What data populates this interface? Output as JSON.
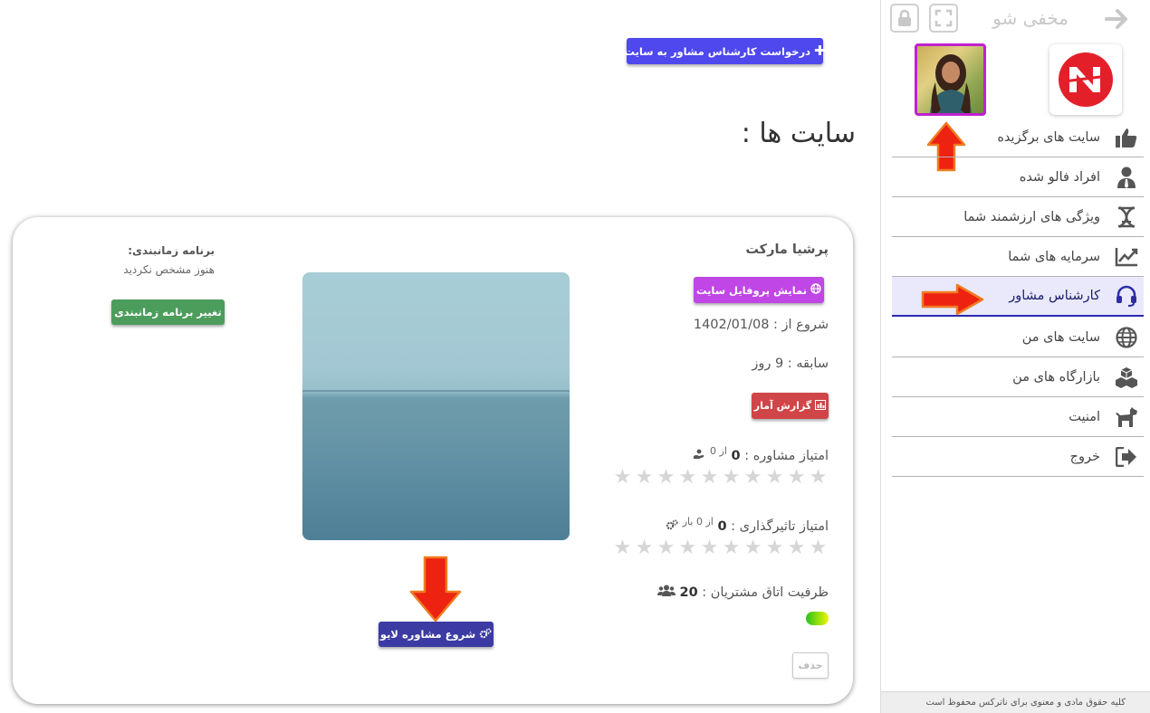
{
  "main": {
    "request_button": "درخواست کارشناس مشاور به سایت",
    "page_title": "سایت ها :",
    "card": {
      "site_name": "پرشیا مارکت",
      "profile_button": "نمایش پروفایل سایت",
      "start_label": "شروع از :",
      "start_date": "1402/01/08",
      "tenure_label": "سابقه :",
      "tenure_value": "9 روز",
      "report_button": "گزارش آمار",
      "consult_score_label": "امتیاز مشاوره :",
      "consult_score_value": "0",
      "consult_score_of": "از 0",
      "consult_score_fraction": 0,
      "impact_score_label": "امتیاز تاثیرگذاری :",
      "impact_score_value": "0",
      "impact_score_of": "از 0 بار",
      "impact_score_fraction": 0,
      "capacity_label": "ظرفیت اتاق مشتریان :",
      "capacity_value": "20",
      "delete_button": "حذف",
      "live_button": "شروع مشاوره لایو",
      "schedule_label": "برنامه زمانبندی:",
      "schedule_value": "هنوز مشخص نکردید",
      "schedule_button": "تغییر برنامه زمانبندی"
    }
  },
  "sidebar": {
    "hide_label": "مخفی شو",
    "items": [
      {
        "label": "سایت های برگزیده",
        "icon": "thumbs-up-icon"
      },
      {
        "label": "افراد فالو شده",
        "icon": "user-tie-icon"
      },
      {
        "label": "ویژگی های ارزشمند شما",
        "icon": "dna-icon"
      },
      {
        "label": "سرمایه های شما",
        "icon": "chart-line-icon"
      },
      {
        "label": "کارشناس مشاور",
        "icon": "headset-icon",
        "active": true
      },
      {
        "label": "سایت های من",
        "icon": "globe-icon"
      },
      {
        "label": "بازارگاه های من",
        "icon": "cubes-icon"
      },
      {
        "label": "امنیت",
        "icon": "dog-icon"
      },
      {
        "label": "خروج",
        "icon": "sign-out-icon"
      }
    ],
    "footer": "کلیه حقوق مادی و معنوی برای ناترکس محفوظ است"
  },
  "colors": {
    "request_button": "#4e48ee",
    "profile_button": "#c046e6",
    "report_button": "#d04547",
    "live_button": "#3b3ba3",
    "schedule_button": "#4c9d5c",
    "active_nav": "#2a2ab0",
    "annotation_arrow": "#ee2211"
  }
}
